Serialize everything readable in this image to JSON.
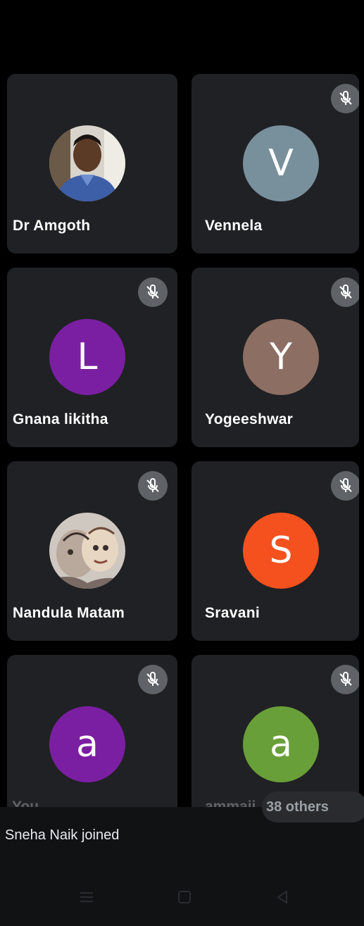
{
  "participants": [
    {
      "name": "Dr Amgoth",
      "initial": "",
      "avatar_type": "photo-man",
      "muted": false
    },
    {
      "name": "Vennela",
      "initial": "V",
      "avatar_color": "#78909c",
      "muted": true
    },
    {
      "name": "Gnana likitha",
      "initial": "L",
      "avatar_color": "#7b1fa2",
      "muted": true
    },
    {
      "name": "Yogeeshwar",
      "initial": "Y",
      "avatar_color": "#8d6e63",
      "muted": true
    },
    {
      "name": "Nandula Matam",
      "initial": "",
      "avatar_type": "photo-sketch",
      "muted": true
    },
    {
      "name": "Sravani",
      "initial": "S",
      "avatar_color": "#f4511e",
      "muted": true
    },
    {
      "name": "You",
      "initial": "a",
      "avatar_color": "#7b1fa2",
      "muted": true
    },
    {
      "name": "ammaji",
      "initial": "a",
      "avatar_color": "#689f38",
      "muted": true
    }
  ],
  "others_label": "38 others",
  "toast": "Sneha Naik joined",
  "icons": {
    "mic_off": "mic-off-icon",
    "nav_menu": "menu-icon",
    "nav_home": "home-icon",
    "nav_back": "back-icon"
  }
}
